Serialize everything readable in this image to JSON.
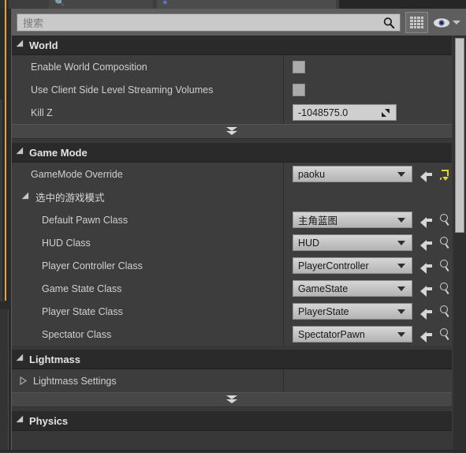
{
  "window": {
    "tabs": [
      {
        "label": "",
        "icon": "search-icon"
      },
      {
        "label": "",
        "icon": "globe-icon"
      }
    ]
  },
  "search": {
    "placeholder": "搜索",
    "value": "",
    "search_icon": "search-icon",
    "grid_button_icon": "grid-view-icon",
    "eye_button_icon": "eye-icon",
    "eye_dropdown_icon": "chevron-down-icon"
  },
  "sections": [
    {
      "id": "world",
      "title": "World",
      "expanded": true,
      "rows": [
        {
          "type": "checkbox",
          "label": "Enable World Composition",
          "checked": false
        },
        {
          "type": "checkbox",
          "label": "Use Client Side Level Streaming Volumes",
          "checked": false
        },
        {
          "type": "number",
          "label": "Kill Z",
          "value": "-1048575.0",
          "drag_icon": "drag-handle-icon"
        }
      ],
      "advanced_toggle": "show-advanced-icon"
    },
    {
      "id": "game_mode",
      "title": "Game Mode",
      "expanded": true,
      "rows": [
        {
          "type": "combo",
          "label": "GameMode Override",
          "value": "paoku",
          "icons": [
            "use-selected-asset-icon",
            "reset-to-default-icon"
          ]
        },
        {
          "type": "subgroup",
          "label": "选中的游戏模式",
          "expanded": true
        },
        {
          "type": "combo",
          "label": "Default Pawn Class",
          "indent": 2,
          "value": "主角蓝图",
          "icons": [
            "use-selected-asset-icon",
            "browse-asset-icon"
          ]
        },
        {
          "type": "combo",
          "label": "HUD Class",
          "indent": 2,
          "value": "HUD",
          "icons": [
            "use-selected-asset-icon",
            "browse-asset-icon"
          ]
        },
        {
          "type": "combo",
          "label": "Player Controller Class",
          "indent": 2,
          "value": "PlayerController",
          "icons": [
            "use-selected-asset-icon",
            "browse-asset-icon"
          ]
        },
        {
          "type": "combo",
          "label": "Game State Class",
          "indent": 2,
          "value": "GameState",
          "icons": [
            "use-selected-asset-icon",
            "browse-asset-icon"
          ]
        },
        {
          "type": "combo",
          "label": "Player State Class",
          "indent": 2,
          "value": "PlayerState",
          "icons": [
            "use-selected-asset-icon",
            "browse-asset-icon"
          ]
        },
        {
          "type": "combo",
          "label": "Spectator Class",
          "indent": 2,
          "value": "SpectatorPawn",
          "icons": [
            "use-selected-asset-icon",
            "browse-asset-icon"
          ]
        }
      ]
    },
    {
      "id": "lightmass",
      "title": "Lightmass",
      "expanded": true,
      "rows": [
        {
          "type": "expandable",
          "label": "Lightmass Settings",
          "expanded": false
        }
      ],
      "advanced_toggle": "show-advanced-icon"
    },
    {
      "id": "physics",
      "title": "Physics",
      "expanded": true,
      "rows": []
    }
  ],
  "scrollbar": {
    "orientation": "vertical",
    "thumb_top_pct": 0,
    "thumb_height_pct": 47
  },
  "colors": {
    "panel_bg": "#383838",
    "row_bg": "#3d3d3d",
    "header_bg": "#2a2a2a",
    "accent": "#e8a33d",
    "reset_yellow": "#e3d427",
    "text": "#cfcfcf"
  }
}
